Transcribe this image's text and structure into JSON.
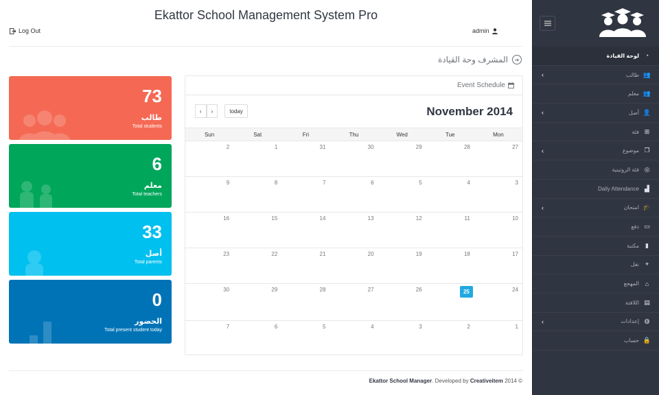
{
  "header": {
    "app_title": "Ekattor School Management System Pro",
    "logout_label": "Log Out",
    "user_label": "admin"
  },
  "page": {
    "title": "المشرف وحة القيادة"
  },
  "tiles": [
    {
      "value": "73",
      "label": "طالب",
      "sub": "Total students",
      "color": "#f56954",
      "icon": "users-icon"
    },
    {
      "value": "6",
      "label": "معلم",
      "sub": "Total teachers",
      "color": "#00a65a",
      "icon": "teachers-icon"
    },
    {
      "value": "33",
      "label": "أصل",
      "sub": "Total parents",
      "color": "#00c0ef",
      "icon": "parent-icon"
    },
    {
      "value": "0",
      "label": "الحضور",
      "sub": "Total present student today",
      "color": "#0073b7",
      "icon": "bar-chart-icon"
    }
  ],
  "calendar": {
    "panel_title": "Event Schedule",
    "month_title": "November 2014",
    "prev_label": "‹",
    "next_label": "›",
    "today_label": "today",
    "weekdays": [
      "Sun",
      "Sat",
      "Fri",
      "Thu",
      "Wed",
      "Tue",
      "Mon"
    ],
    "weeks": [
      [
        "2",
        "1",
        "31",
        "30",
        "29",
        "28",
        "27"
      ],
      [
        "9",
        "8",
        "7",
        "6",
        "5",
        "4",
        "3"
      ],
      [
        "16",
        "15",
        "14",
        "13",
        "12",
        "11",
        "10"
      ],
      [
        "23",
        "22",
        "21",
        "20",
        "19",
        "18",
        "17"
      ],
      [
        "30",
        "29",
        "28",
        "27",
        "26",
        "25",
        "24"
      ],
      [
        "7",
        "6",
        "5",
        "4",
        "3",
        "2",
        "1"
      ]
    ],
    "today_day": "25"
  },
  "footer": {
    "brand": "Ekattor School Manager",
    "developed_by": ". Developed by",
    "developer": "Creativeitem",
    "year": "2014 ©"
  },
  "sidebar": {
    "items": [
      {
        "label": "لوحة القيادة",
        "icon": "dashboard-icon",
        "active": true,
        "expandable": false
      },
      {
        "label": "طالب",
        "icon": "users-icon",
        "active": false,
        "expandable": true
      },
      {
        "label": "معلم",
        "icon": "teacher-icon",
        "active": false,
        "expandable": false
      },
      {
        "label": "أصل",
        "icon": "user-icon",
        "active": false,
        "expandable": true
      },
      {
        "label": "فئة",
        "icon": "sitemap-icon",
        "active": false,
        "expandable": false
      },
      {
        "label": "موضوع",
        "icon": "books-icon",
        "active": false,
        "expandable": true
      },
      {
        "label": "فئة الروتينية",
        "icon": "target-icon",
        "active": false,
        "expandable": false
      },
      {
        "label": "Daily Attendance",
        "icon": "signal-icon",
        "active": false,
        "expandable": false
      },
      {
        "label": "امتحان",
        "icon": "graduation-icon",
        "active": false,
        "expandable": true
      },
      {
        "label": "دفع",
        "icon": "credit-card-icon",
        "active": false,
        "expandable": false
      },
      {
        "label": "مكتبة",
        "icon": "book-icon",
        "active": false,
        "expandable": false
      },
      {
        "label": "نقل",
        "icon": "location-icon",
        "active": false,
        "expandable": false
      },
      {
        "label": "المهجع",
        "icon": "home-icon",
        "active": false,
        "expandable": false
      },
      {
        "label": "اللافتة",
        "icon": "document-icon",
        "active": false,
        "expandable": false
      },
      {
        "label": "إعدادات",
        "icon": "globe-icon",
        "active": false,
        "expandable": true
      },
      {
        "label": "حساب",
        "icon": "lock-icon",
        "active": false,
        "expandable": false
      }
    ]
  }
}
